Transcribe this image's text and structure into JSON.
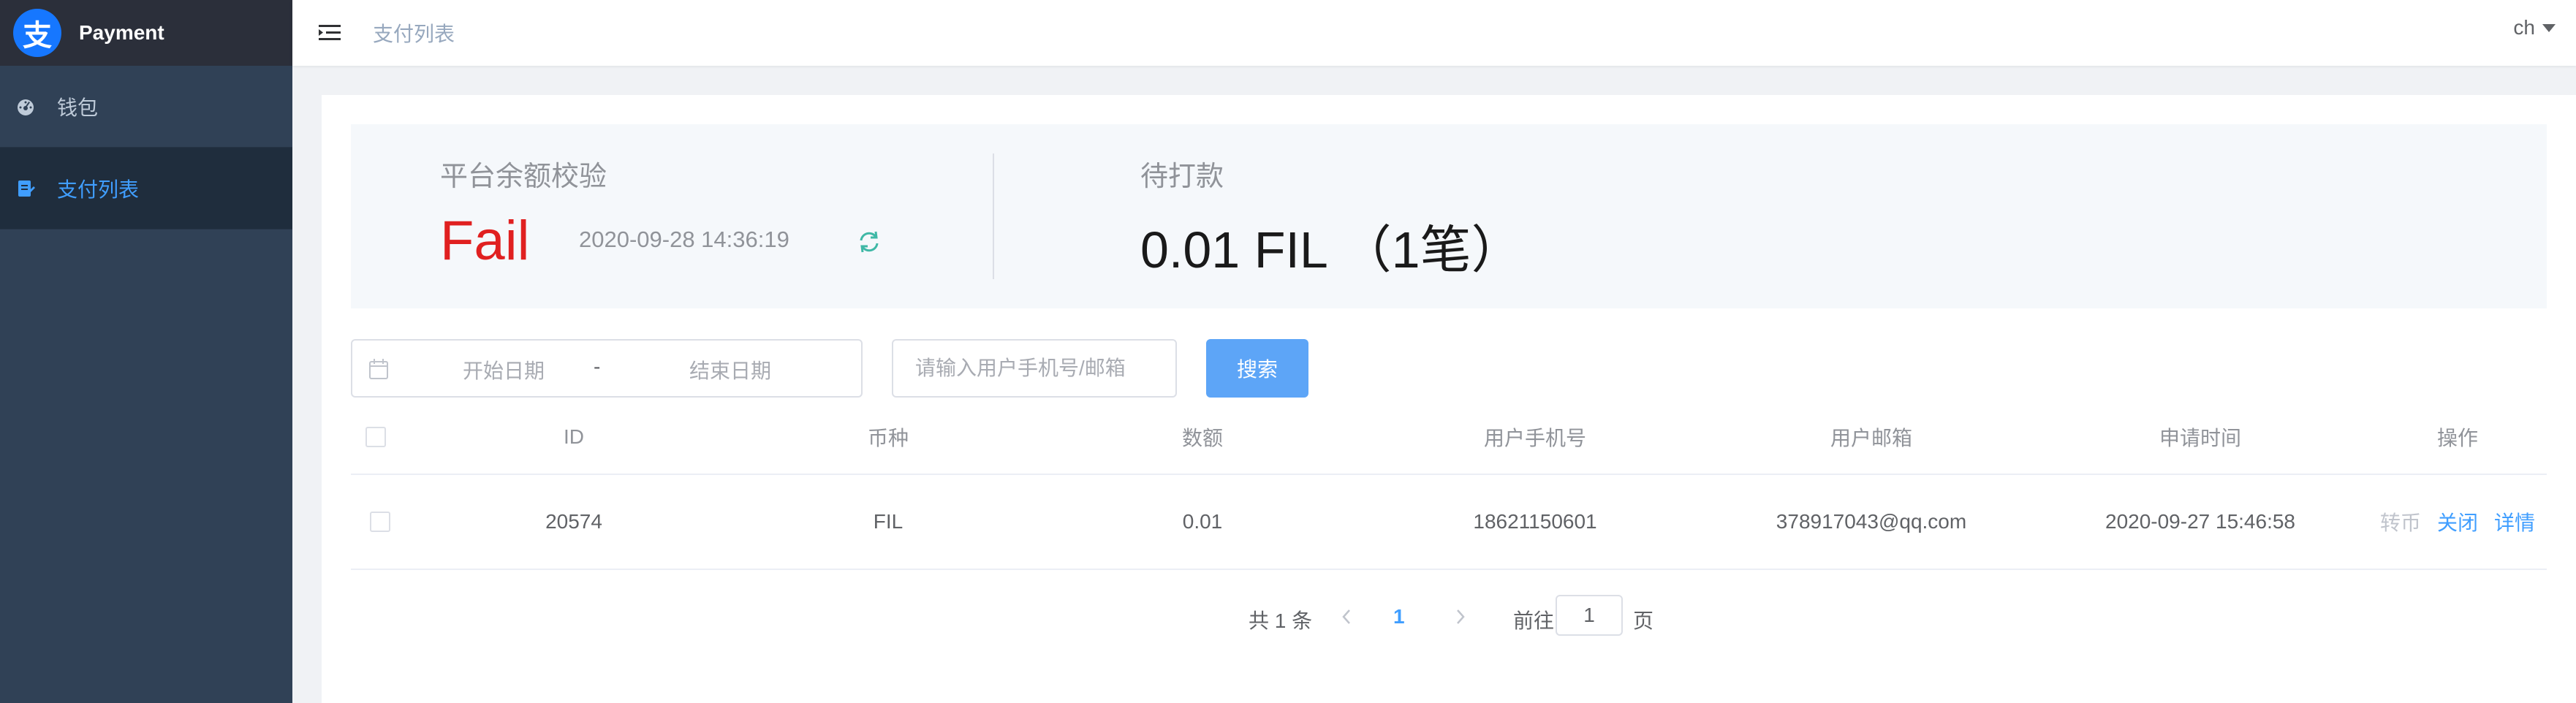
{
  "app": {
    "title": "Payment",
    "logo_glyph": "支",
    "accent": "#409eff"
  },
  "sidebar": {
    "items": [
      {
        "label": "钱包",
        "icon": "dashboard-icon",
        "active": false
      },
      {
        "label": "支付列表",
        "icon": "document-icon",
        "active": true
      }
    ]
  },
  "header": {
    "breadcrumb": "支付列表",
    "language": "ch"
  },
  "summary": {
    "balance_check_label": "平台余额校验",
    "status": "Fail",
    "status_color": "#e02020",
    "timestamp": "2020-09-28 14:36:19",
    "pending_label": "待打款",
    "pending_amount": "0.01 FIL （1笔）"
  },
  "filters": {
    "start_date_placeholder": "开始日期",
    "separator": "-",
    "end_date_placeholder": "结束日期",
    "search_placeholder": "请输入用户手机号/邮箱",
    "search_button": "搜索"
  },
  "table": {
    "columns": [
      "ID",
      "币种",
      "数额",
      "用户手机号",
      "用户邮箱",
      "申请时间",
      "操作"
    ],
    "rows": [
      {
        "id": "20574",
        "currency": "FIL",
        "amount": "0.01",
        "phone": "18621150601",
        "email": "378917043@qq.com",
        "time": "2020-09-27 15:46:58",
        "actions": [
          "转币",
          "关闭",
          "详情"
        ]
      }
    ]
  },
  "pagination": {
    "total": "共 1 条",
    "current_page": "1",
    "goto_label": "前往",
    "goto_value": "1",
    "page_suffix": "页"
  }
}
